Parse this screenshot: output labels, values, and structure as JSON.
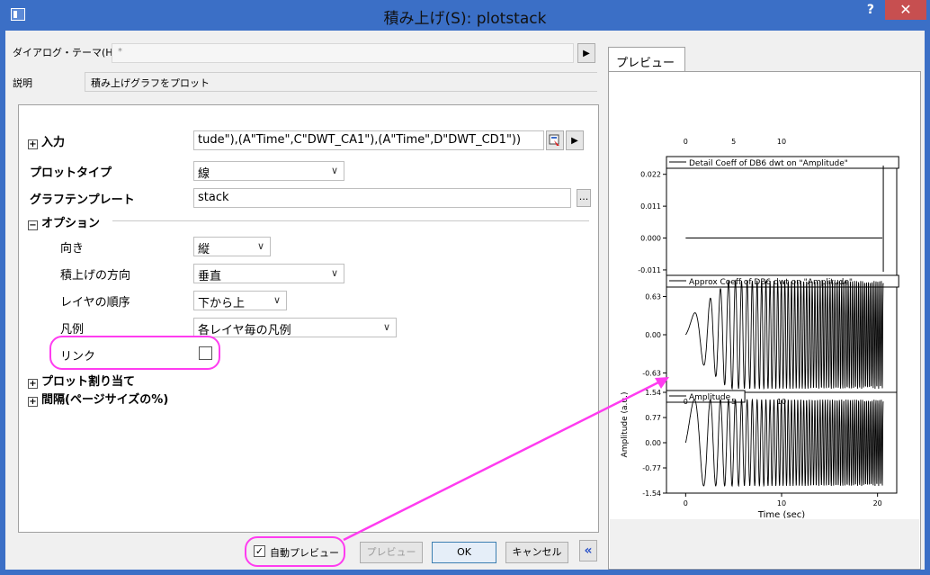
{
  "window": {
    "title": "積み上げ(S): plotstack",
    "help_label": "?",
    "close_label": "✕"
  },
  "theme": {
    "label": "ダイアログ・テーマ(H)",
    "value": "*",
    "arrow": "▶"
  },
  "description": {
    "label": "説明",
    "value": "積み上げグラフをプロット"
  },
  "form": {
    "input": {
      "label": "入力",
      "value": "tude\"),(A\"Time\",C\"DWT_CA1\"),(A\"Time\",D\"DWT_CD1\"))"
    },
    "plot_type": {
      "label": "プロットタイプ",
      "value": "線"
    },
    "graph_template": {
      "label": "グラフテンプレート",
      "value": "stack",
      "browse": "..."
    },
    "options": {
      "label": "オプション",
      "orientation": {
        "label": "向き",
        "value": "縦"
      },
      "stack_direction": {
        "label": "積上げの方向",
        "value": "垂直"
      },
      "layer_order": {
        "label": "レイヤの順序",
        "value": "下から上"
      },
      "legend": {
        "label": "凡例",
        "value": "各レイヤ毎の凡例"
      },
      "link": {
        "label": "リンク",
        "checked": false
      }
    },
    "plot_assign": {
      "label": "プロット割り当て"
    },
    "spacing": {
      "label": "間隔(ページサイズの%)"
    }
  },
  "footer": {
    "auto_preview_label": "自動プレビュー",
    "auto_preview_checked": true,
    "preview_label": "プレビュー",
    "ok_label": "OK",
    "cancel_label": "キャンセル",
    "collapse_label": "«"
  },
  "preview_tab": {
    "label": "プレビュー"
  },
  "highlight_color": "#ff3cf0",
  "chart_data": [
    {
      "type": "line",
      "title": "Detail Coeff of DB6 dwt on \"Amplitude\"",
      "xlim": [
        -2,
        22
      ],
      "x_ticks_top": [
        "0",
        "5",
        "10"
      ],
      "y_ticks": [
        "0.022",
        "0.011",
        "0.000",
        "-0.011"
      ],
      "ylim": [
        -0.0135,
        0.0275
      ]
    },
    {
      "type": "line",
      "title": "Approx Coeff of DB6 dwt on \"Amplitude\"",
      "y_ticks": [
        "0.63",
        "0.00",
        "-0.63"
      ],
      "ylim": [
        -0.95,
        0.95
      ]
    },
    {
      "type": "line",
      "title": "Amplitude",
      "x_ticks_top": [
        "0",
        "5",
        "10"
      ],
      "x_ticks_bottom": [
        "0",
        "10",
        "20"
      ],
      "y_ticks": [
        "1.54",
        "0.77",
        "0.00",
        "-0.77",
        "-1.54"
      ],
      "xlabel": "Time (sec)",
      "ylabel": "Amplitude (a.u.)",
      "ylim": [
        -1.54,
        1.54
      ]
    }
  ]
}
